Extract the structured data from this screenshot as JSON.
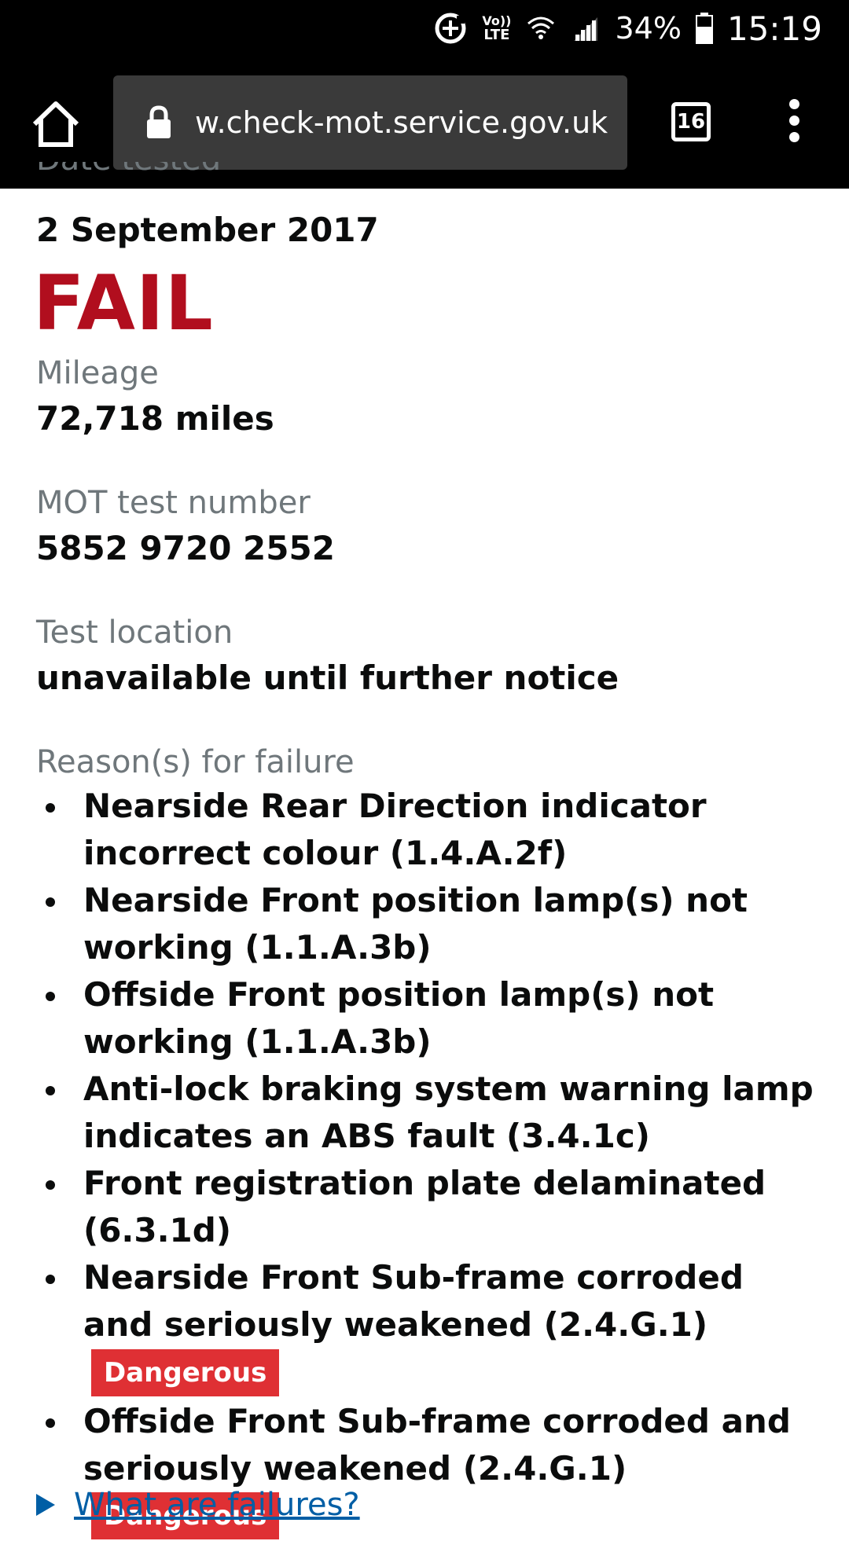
{
  "status_bar": {
    "battery": "34%",
    "time": "15:19",
    "network": "LTE",
    "volte": "Vo))"
  },
  "browser": {
    "url": "w.check-mot.service.gov.uk",
    "tab_count": "16"
  },
  "mot": {
    "date_label": "Date tested",
    "date_value": "2 September 2017",
    "result": "FAIL",
    "mileage_label": "Mileage",
    "mileage_value": "72,718 miles",
    "test_number_label": "MOT test number",
    "test_number_value": "5852 9720 2552",
    "location_label": "Test location",
    "location_value": "unavailable until further notice",
    "reasons_label": "Reason(s) for failure",
    "reasons": [
      {
        "text": "Nearside Rear Direction indicator incorrect colour (1.4.A.2f)",
        "tag": ""
      },
      {
        "text": "Nearside Front position lamp(s) not working (1.1.A.3b)",
        "tag": ""
      },
      {
        "text": "Offside Front position lamp(s) not working (1.1.A.3b)",
        "tag": ""
      },
      {
        "text": "Anti-lock braking system warning lamp indicates an ABS fault (3.4.1c)",
        "tag": ""
      },
      {
        "text": "Front registration plate delaminated (6.3.1d)",
        "tag": ""
      },
      {
        "text": "Nearside Front Sub-frame corroded and seriously weakened (2.4.G.1)",
        "tag": "Dangerous"
      },
      {
        "text": "Offside Front Sub-frame corroded and seriously weakened (2.4.G.1)",
        "tag": "Dangerous"
      }
    ],
    "failures_link": "What are failures?"
  },
  "colors": {
    "fail_red": "#b10e1e",
    "dangerous_tag": "#df3034",
    "label_grey": "#6f777b",
    "link_blue": "#005ea5"
  }
}
